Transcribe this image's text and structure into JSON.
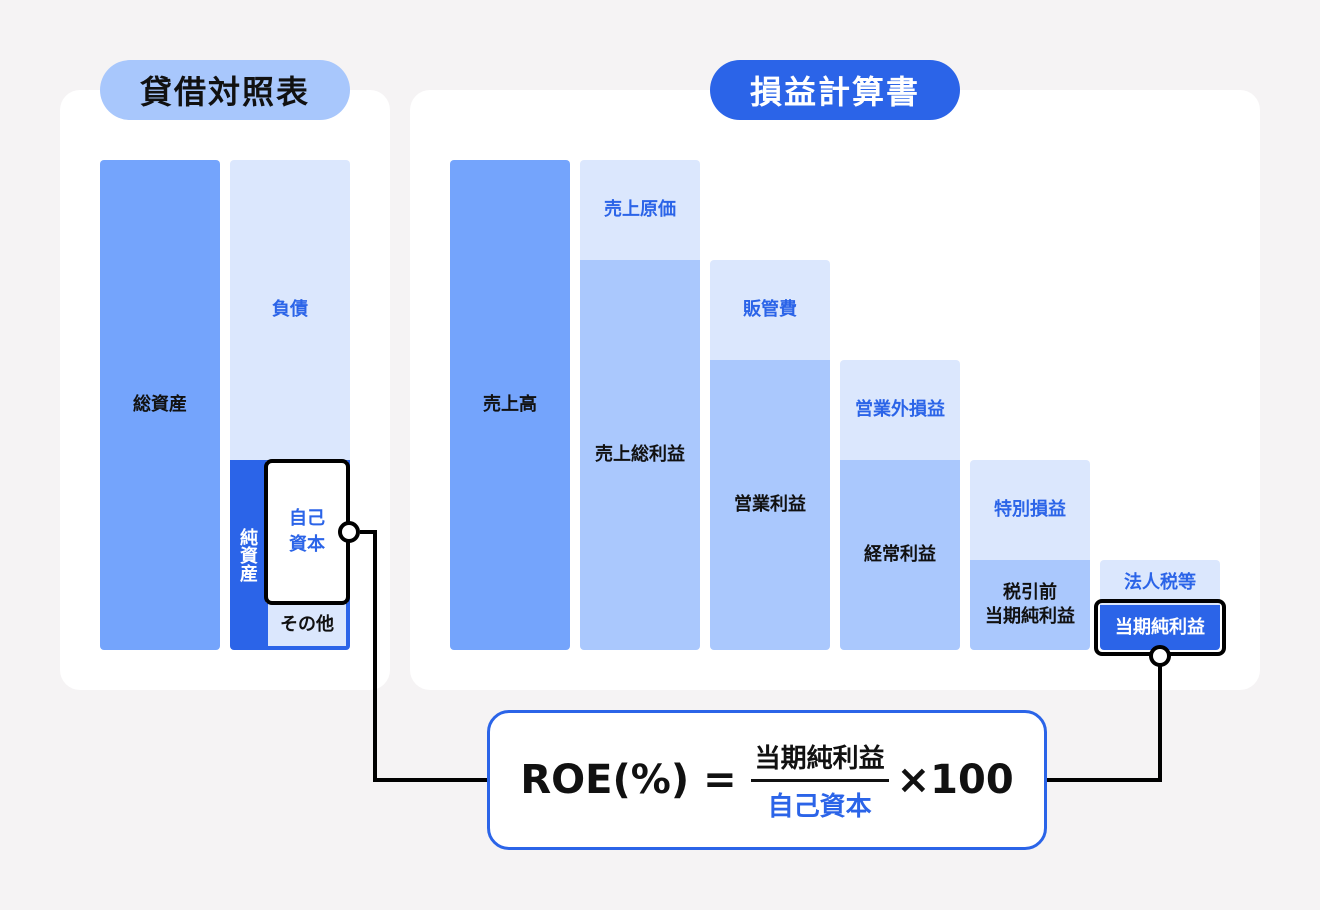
{
  "balance_sheet": {
    "title": "貸借対照表",
    "total_assets": "総資産",
    "liabilities": "負債",
    "net_assets": "純資産",
    "equity": "自己資本",
    "other": "その他"
  },
  "income_statement": {
    "title": "損益計算書",
    "sales": "売上高",
    "cost_of_sales": "売上原価",
    "gross_profit": "売上総利益",
    "sga": "販管費",
    "operating_income": "営業利益",
    "non_operating": "営業外損益",
    "ordinary_income": "経常利益",
    "extraordinary": "特別損益",
    "pretax_income_line1": "税引前",
    "pretax_income_line2": "当期純利益",
    "taxes": "法人税等",
    "net_income": "当期純利益"
  },
  "formula": {
    "lhs": "ROE(%)",
    "equals": "=",
    "numerator": "当期純利益",
    "denominator": "自己資本",
    "multiplier": "×100"
  },
  "colors": {
    "accent_blue": "#2b64e8",
    "dark_bar": "#74a4fc",
    "mid_bar": "#aac8fd",
    "light_bar": "#dbe7fd",
    "pill_light": "#a8c7fc"
  }
}
